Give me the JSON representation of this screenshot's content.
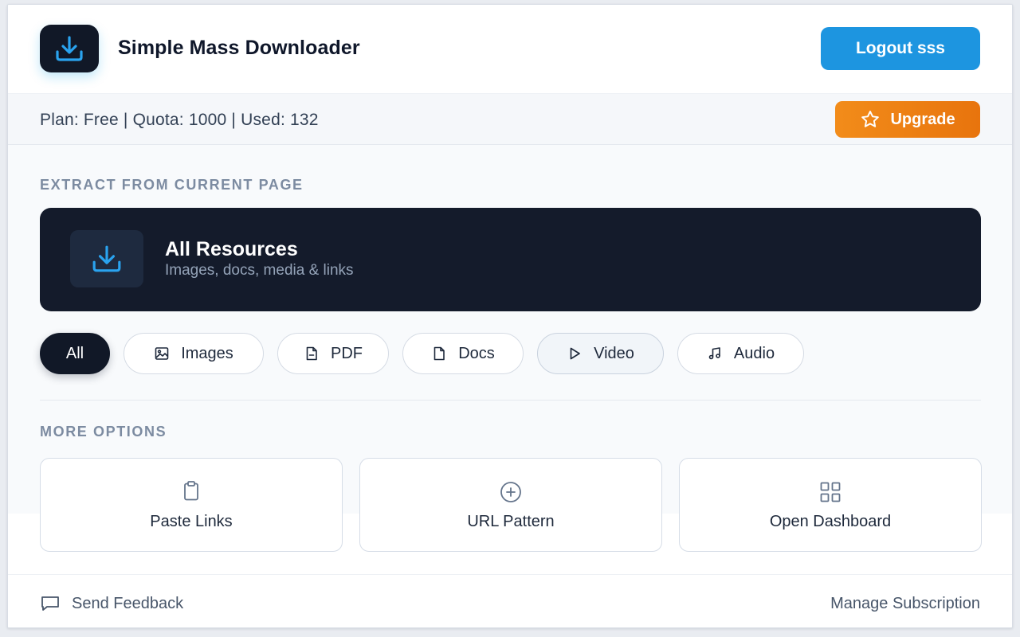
{
  "header": {
    "title": "Simple Mass Downloader",
    "logout_label": "Logout sss"
  },
  "plan": {
    "text": "Plan: Free | Quota: 1000 | Used: 132",
    "upgrade_label": "Upgrade"
  },
  "extract": {
    "section_label": "EXTRACT FROM CURRENT PAGE",
    "card_title": "All Resources",
    "card_subtitle": "Images, docs, media & links"
  },
  "filters": [
    {
      "label": "All",
      "icon": "none",
      "state": "selected"
    },
    {
      "label": "Images",
      "icon": "image-icon"
    },
    {
      "label": "PDF",
      "icon": "pdf-file-icon"
    },
    {
      "label": "Docs",
      "icon": "document-icon"
    },
    {
      "label": "Video",
      "icon": "play-icon"
    },
    {
      "label": "Audio",
      "icon": "music-note-icon"
    }
  ],
  "more_options": {
    "section_label": "MORE OPTIONS",
    "items": [
      {
        "label": "Paste Links",
        "icon": "clipboard-icon"
      },
      {
        "label": "URL Pattern",
        "icon": "plus-circle-icon"
      },
      {
        "label": "Open Dashboard",
        "icon": "grid-icon"
      }
    ]
  },
  "footer": {
    "feedback_label": "Send Feedback",
    "manage_label": "Manage Subscription"
  },
  "colors": {
    "primary_blue": "#1d95e0",
    "upgrade_orange": "#ef8416",
    "dark": "#111827",
    "muted_label": "#7c8ba1"
  }
}
